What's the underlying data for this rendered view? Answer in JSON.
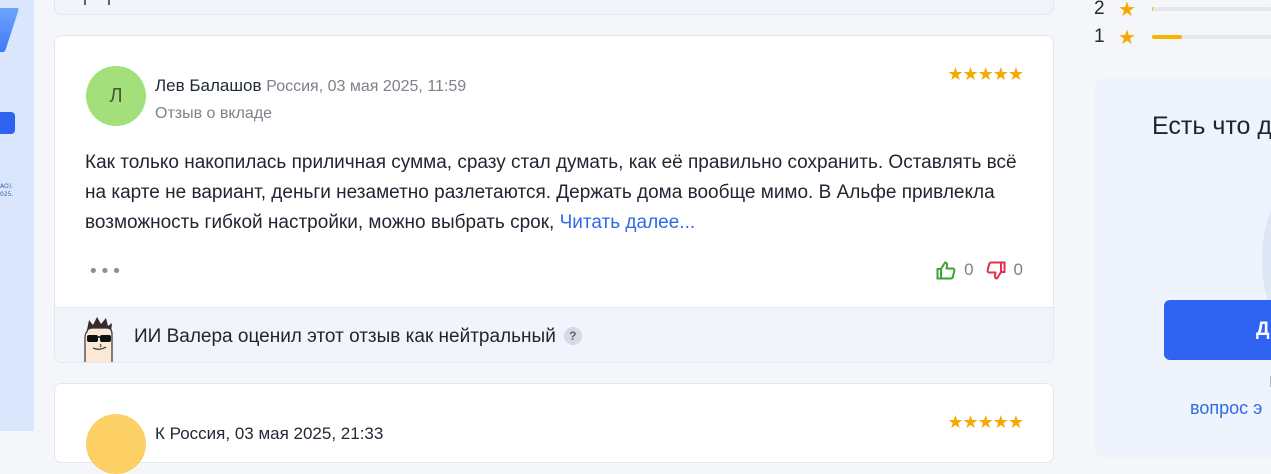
{
  "review": {
    "avatar_letter": "Л",
    "author_name": "Лев Балашов",
    "author_meta": "Россия, 03 мая 2025, 11:59",
    "review_type": "Отзыв о вкладе",
    "stars": "★★★★★",
    "text": "Как только накопилась приличная сумма, сразу стал думать, как её правильно сохранить. Оставлять всё на карте не вариант, деньги незаметно разлетаются. Держать дома вообще мимо. В Альфе привлекла возможность гибкой настройки, можно выбрать срок, ",
    "read_more": "Читать далее...",
    "more_dots": "•••",
    "likes": "0",
    "dislikes": "0",
    "ai_verdict": "ИИ Валера оценил этот отзыв как нейтральный",
    "help_badge": "?"
  },
  "next_review": {
    "avatar_letter": "",
    "author_line": "К          Россия, 03 мая 2025, 21:33",
    "stars": "★★★★★"
  },
  "rating_breakdown": [
    {
      "label": "2",
      "star": "★",
      "share": 0.01
    },
    {
      "label": "1",
      "star": "★",
      "share": 0.25
    }
  ],
  "ask_panel": {
    "title": "Есть что д",
    "button_label": "Д",
    "sub_text": "I",
    "link_text": "вопрос э"
  },
  "sidebar": {
    "tiny_text_1": "AO).",
    "tiny_text_2": "025."
  },
  "colors": {
    "accent": "#2f63f2",
    "star": "#f7a800",
    "like": "#3aa52c",
    "dislike": "#e2304d"
  }
}
